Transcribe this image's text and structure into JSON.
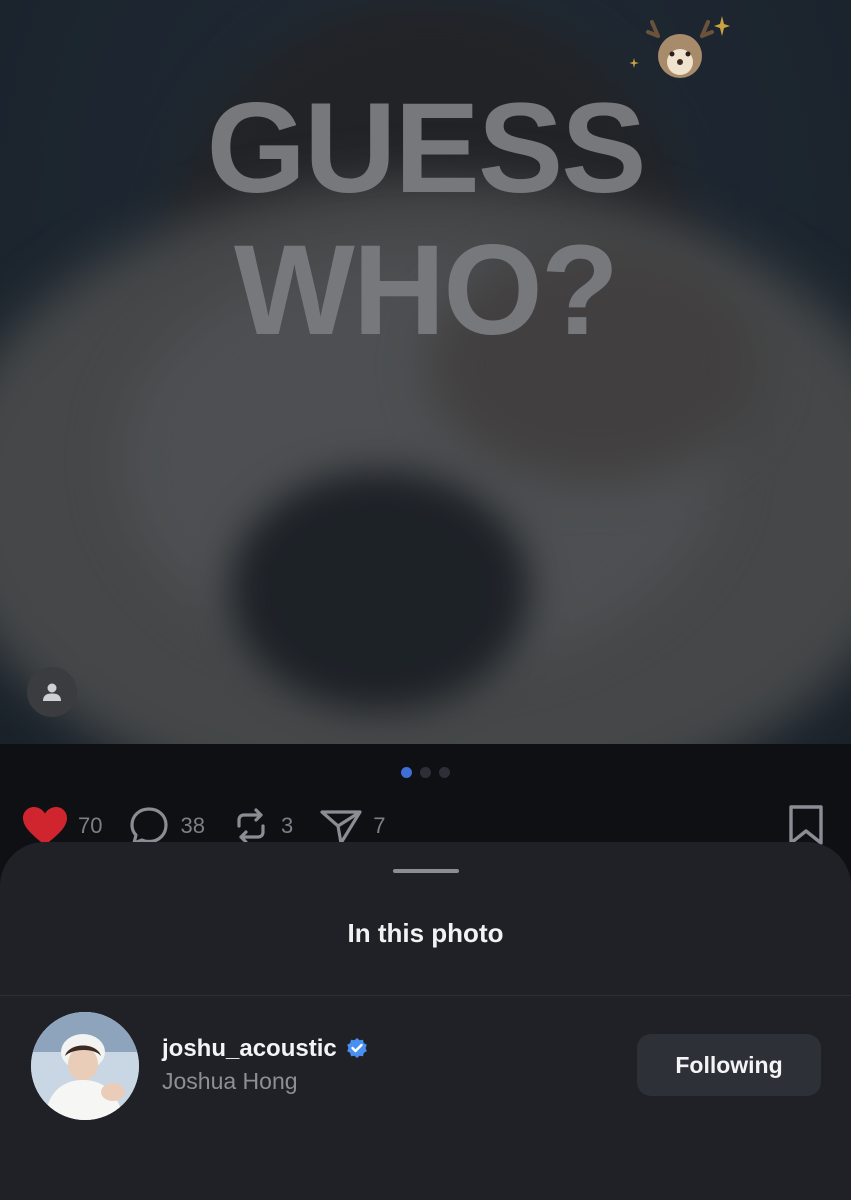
{
  "photo": {
    "overlay_text_line1": "GUESS",
    "overlay_text_line2": "WHO?",
    "sticker_icon": "reindeer-sticker-icon",
    "tag_toggle_icon": "person-icon",
    "carousel": {
      "count": 3,
      "active_index": 0
    }
  },
  "actions": {
    "likes": "70",
    "comments": "38",
    "reposts": "3",
    "shares": "7",
    "like_color": "#d0242e"
  },
  "sheet": {
    "title": "In this photo",
    "tagged": {
      "username": "joshu_acoustic",
      "display_name": "Joshua Hong",
      "verified": true,
      "follow_label": "Following"
    }
  },
  "colors": {
    "accent": "#3d6fd6",
    "verified": "#4a90f0",
    "sheet_bg": "#202127"
  }
}
